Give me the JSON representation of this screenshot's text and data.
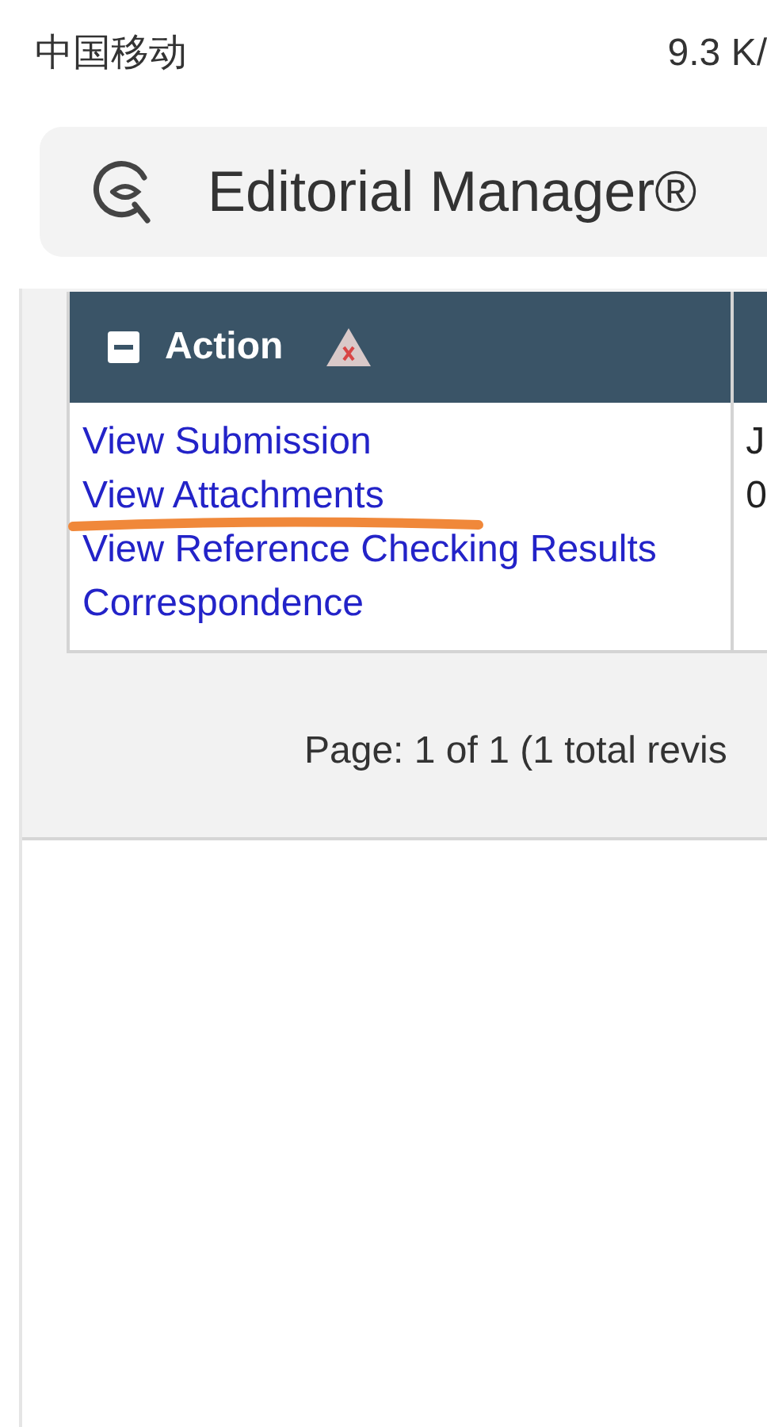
{
  "status_bar": {
    "carrier": "中国移动",
    "speed": "9.3 K/"
  },
  "browser": {
    "title": "Editorial Manager®"
  },
  "table": {
    "columns": [
      {
        "label": "Action"
      }
    ],
    "rows": [
      {
        "actions": [
          "View Submission",
          "View Attachments",
          "View Reference Checking Results",
          "Correspondence"
        ],
        "column_2": [
          "J",
          "0"
        ]
      }
    ]
  },
  "pagination": "Page: 1 of 1 (1 total revis"
}
